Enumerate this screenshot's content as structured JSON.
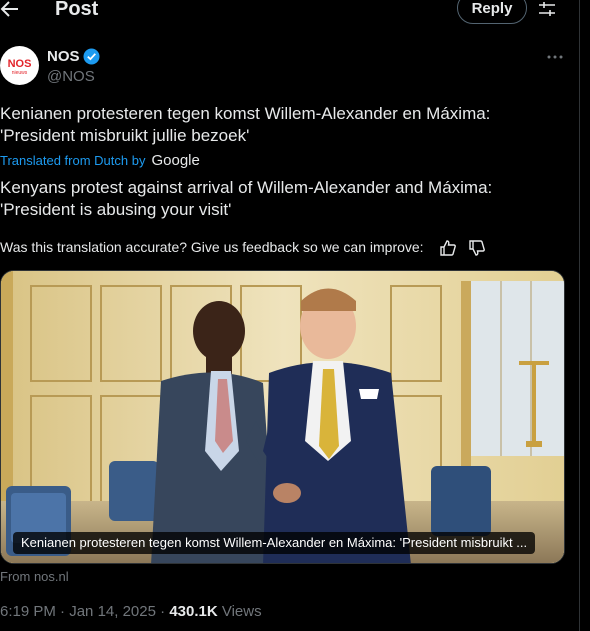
{
  "header": {
    "back_icon": "arrow-left-icon",
    "title": "Post",
    "reply_label": "Reply",
    "tune_icon": "sliders-icon"
  },
  "account": {
    "name": "NOS",
    "handle": "@NOS",
    "avatar_text_top": "NOS",
    "avatar_text_bottom": "nieuws",
    "verified_color": "#1d9bf0"
  },
  "tweet": {
    "original_line1": "Kenianen protesteren tegen komst Willem-Alexander en Máxima:",
    "original_line2": "'President misbruikt jullie bezoek'",
    "translated_from": "Translated from Dutch by",
    "translator": "Google",
    "translation_line1": "Kenyans protest against arrival of Willem-Alexander and Máxima:",
    "translation_line2": "'President is abusing your visit'",
    "feedback_question": "Was this translation accurate? Give us feedback so we can improve:"
  },
  "card": {
    "caption": "Kenianen protesteren tegen komst Willem-Alexander en Máxima: 'President misbruikt ...",
    "source": "From nos.nl"
  },
  "meta": {
    "time": "6:19 PM",
    "separator": "·",
    "date": "Jan 14, 2025",
    "views_count": "430.1K",
    "views_label": "Views"
  },
  "colors": {
    "accent": "#1d9bf0",
    "muted": "#71767b",
    "background": "#000000"
  }
}
